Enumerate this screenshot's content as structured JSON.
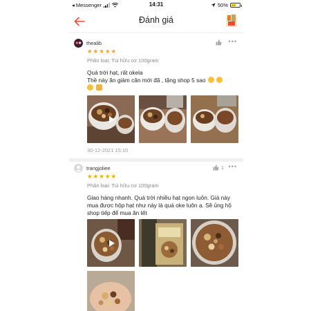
{
  "status_bar": {
    "carrier": "◂ Messenger",
    "time": "14:31",
    "battery": "50%",
    "battery_level": 0.5
  },
  "header": {
    "title": "Đánh giá"
  },
  "reviews": [
    {
      "username": "thealib",
      "rating": 5,
      "variant": "Phân loại: Túi hữu cơ 100gram",
      "content_line1": "Quá trời hạt, rất okela",
      "content_line2": "Thề này ăn giảm cân mới đã , tặng shop 5 sao",
      "date": "30-12-2021 15:10",
      "like_count": ""
    },
    {
      "username": "trangjoliee",
      "rating": 5,
      "variant": "Phân loại: Túi hữu cơ 100gram",
      "content": "Giao hàng nhanh. Quá trời nhiều hạt ngon luôn. Giá này mua được hộp hạt như này là quá oke luôn ạ. Sẽ ủng hộ shop tiếp để mua ăn tết",
      "like_count": "1"
    }
  ],
  "colors": {
    "accent": "#ee4d2d",
    "star": "#f6a700"
  }
}
